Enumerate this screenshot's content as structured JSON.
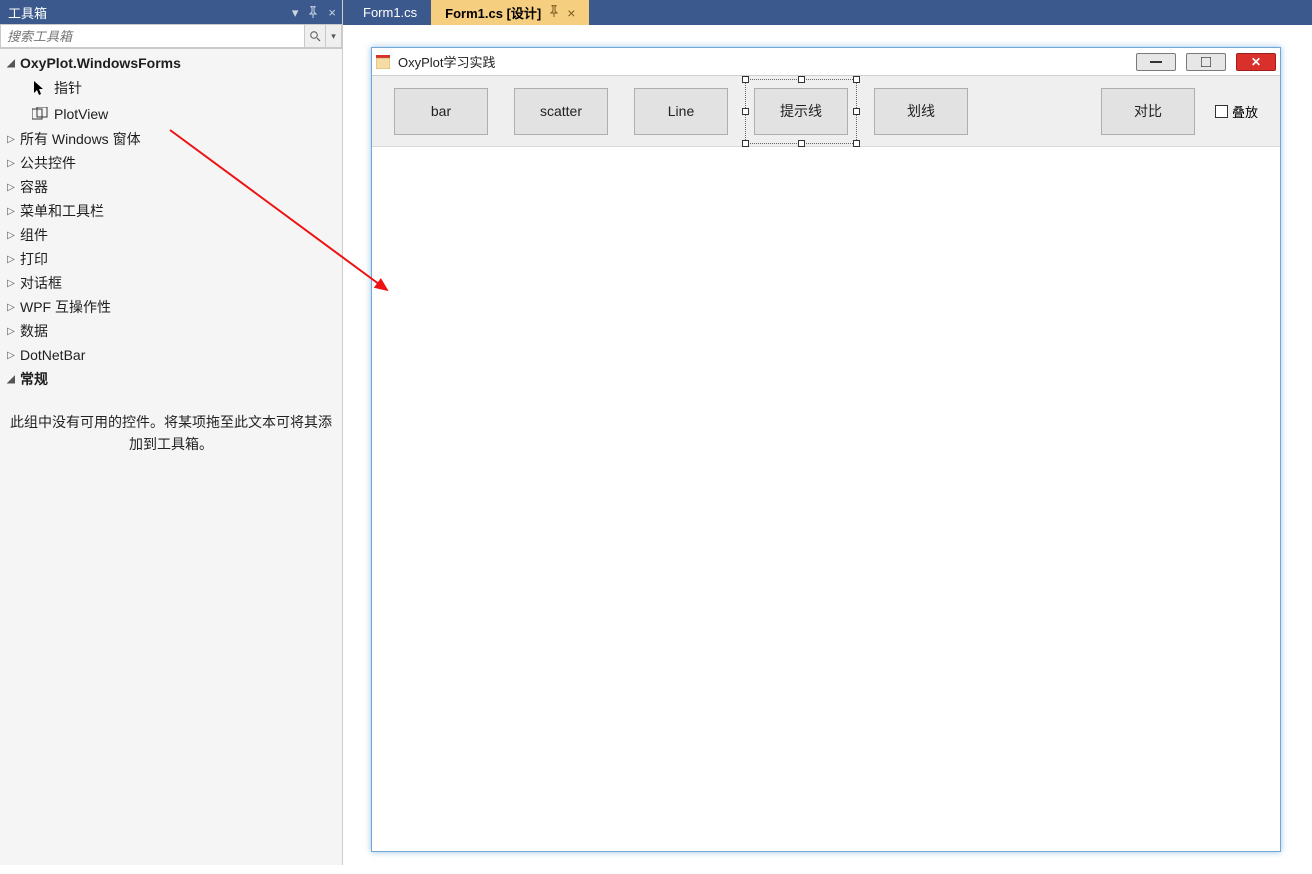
{
  "toolbox": {
    "title": "工具箱",
    "search_placeholder": "搜索工具箱",
    "group_header": "OxyPlot.WindowsForms",
    "items": [
      {
        "label": "指针",
        "icon": "pointer"
      },
      {
        "label": "PlotView",
        "icon": "plotview"
      }
    ],
    "collapsed_groups": [
      "所有 Windows 窗体",
      "公共控件",
      "容器",
      "菜单和工具栏",
      "组件",
      "打印",
      "对话框",
      "WPF 互操作性",
      "数据",
      "DotNetBar"
    ],
    "last_group": "常规",
    "empty_note": "此组中没有可用的控件。将某项拖至此文本可将其添加到工具箱。"
  },
  "tabs": {
    "inactive": "Form1.cs",
    "active": "Form1.cs [设计]"
  },
  "form": {
    "title": "OxyPlot学习实践",
    "buttons": {
      "bar": "bar",
      "scatter": "scatter",
      "line": "Line",
      "hint": "提示线",
      "mark": "划线",
      "compare": "对比"
    },
    "checkbox_label": "叠放"
  }
}
